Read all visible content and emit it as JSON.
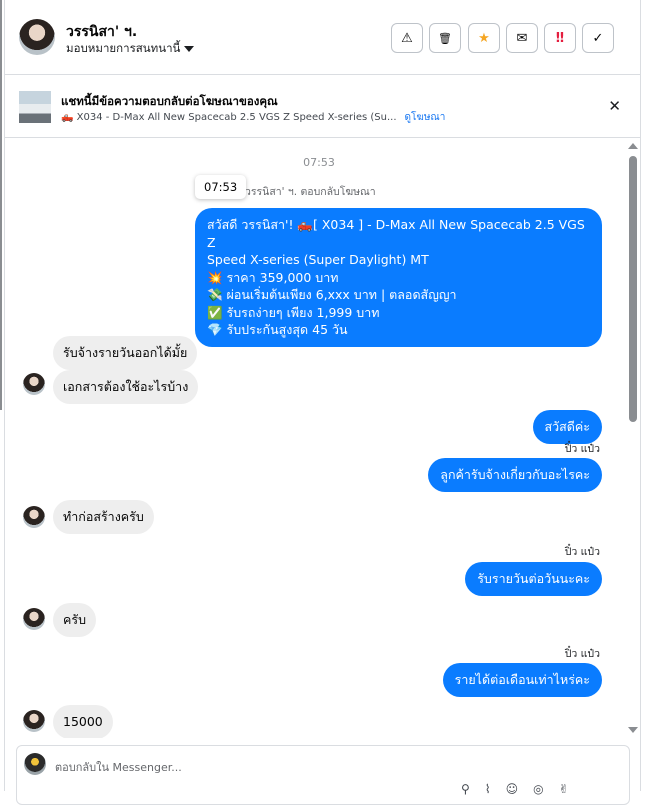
{
  "header": {
    "name": "วรรนิสา' ฯ.",
    "assign_label": "มอบหมายการสนทนานี้",
    "toolbar": {
      "spam": "⚠",
      "delete": "🗑",
      "star": "★",
      "mark_unread": "✉",
      "follow_up": "‼",
      "done": "✓"
    },
    "colors": {
      "star": "#f5a623",
      "follow_up": "#e41e3f"
    }
  },
  "ad_banner": {
    "title": "แชทนี้มีข้อความตอบกลับต่อโฆษณาของคุณ",
    "ad_text": "🛻 X034 - D-Max All New Spacecab 2.5 VGS Z Speed X-series (Su...",
    "link": "ดูโฆษณา"
  },
  "thread": {
    "timestamp": "07:53",
    "tooltip": "07:53",
    "ad_reply_note": "วรรนิสา' ฯ. ตอบกลับโฆษณา",
    "ad_message_lines": [
      "สวัสดี วรรนิสา'! 🛻[ X034 ] - D-Max All New Spacecab 2.5 VGS Z",
      "Speed X-series (Super Daylight) MT",
      "💥 ราคา 359,000 บาท",
      "💸 ผ่อนเริ่มต้นเพียง 6,xxx บาท | ตลอดสัญญา",
      "✅ รับรถง่ายๆ เพียง 1,999 บาท",
      "💎 รับประกันสูงสุด 45 วัน"
    ],
    "messages": [
      {
        "from": "customer",
        "text": "รับจ้างรายวันออกได้มั้ย"
      },
      {
        "from": "customer",
        "text": "เอกสารต้องใช้อะไรบ้าง"
      },
      {
        "from": "page",
        "text": "สวัสดีค่ะ"
      },
      {
        "from": "page",
        "sender": "ปิ๋ว แป๋ว",
        "text": "ลูกค้ารับจ้างเกี่ยวกับอะไรคะ"
      },
      {
        "from": "customer",
        "text": "ทำก่อสร้างครับ"
      },
      {
        "from": "page",
        "sender": "ปิ๋ว แป๋ว",
        "text": "รับรายวันต่อวันนะคะ"
      },
      {
        "from": "customer",
        "text": "ครับ"
      },
      {
        "from": "page",
        "sender": "ปิ๋ว แป๋ว",
        "text": "รายได้ต่อเดือนเท่าไหร่คะ"
      },
      {
        "from": "customer",
        "text": "15000"
      }
    ]
  },
  "composer": {
    "placeholder": "ตอบกลับใน Messenger...",
    "tools": [
      "attach-person-icon",
      "paperclip-icon",
      "emoji-icon",
      "gif-icon",
      "thumbs-up-icon",
      "like-icon"
    ]
  }
}
